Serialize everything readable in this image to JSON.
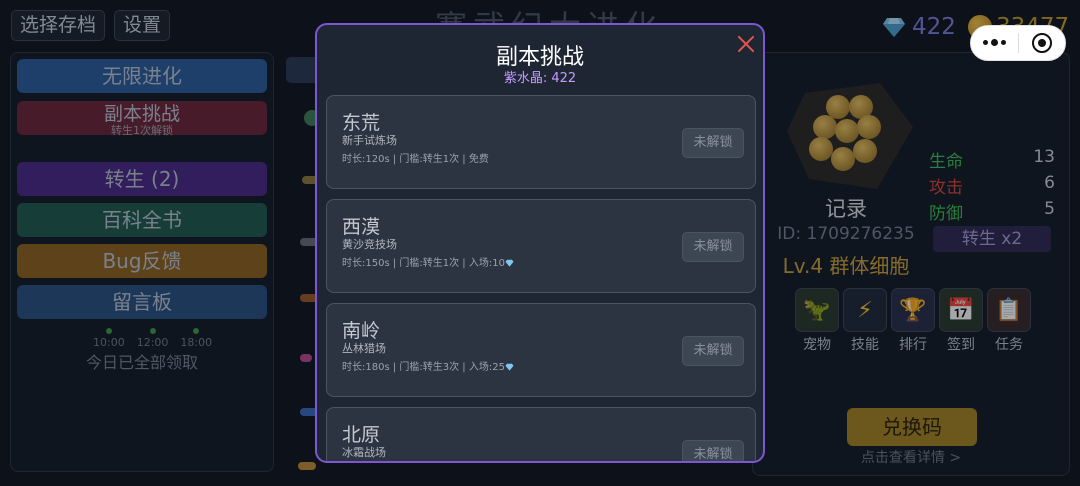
{
  "topbar": {
    "save_select_label": "选择存档",
    "settings_label": "设置",
    "game_title": "赛武纪大进化",
    "gems": "422",
    "coins": "33477"
  },
  "left_menu": {
    "items": [
      {
        "label": "无限进化",
        "color": "#2a5c9a"
      },
      {
        "label": "副本挑战",
        "sub": "转生1次解锁",
        "color": "#6a2637"
      },
      {
        "label": "转生 (2)",
        "color": "#4a2a84"
      },
      {
        "label": "百科全书",
        "color": "#1f5a4e"
      },
      {
        "label": "Bug反馈",
        "color": "#8c6220"
      },
      {
        "label": "留言板",
        "color": "#28517e"
      }
    ],
    "checkin_times": [
      "10:00",
      "12:00",
      "18:00"
    ],
    "checkin_note": "今日已全部领取"
  },
  "right_panel": {
    "stats": [
      {
        "label": "生命",
        "value": "13",
        "color": "#3fbf53"
      },
      {
        "label": "攻击",
        "value": "6",
        "color": "#d4463a"
      },
      {
        "label": "防御",
        "value": "5",
        "color": "#3fbf53"
      }
    ],
    "record_title": "记录",
    "record_id": "ID: 1709276235",
    "level_text": "Lv.4 群体细胞",
    "rebirth_badge": "转生 x2",
    "actions": [
      {
        "label": "宠物",
        "icon": "dinosaur-icon",
        "glyph": "🦖"
      },
      {
        "label": "技能",
        "icon": "lightning-icon",
        "glyph": "⚡"
      },
      {
        "label": "排行",
        "icon": "trophy-icon",
        "glyph": "🏆"
      },
      {
        "label": "签到",
        "icon": "calendar-icon",
        "glyph": "📅"
      },
      {
        "label": "任务",
        "icon": "clipboard-icon",
        "glyph": "📋"
      }
    ],
    "redeem_label": "兑换码",
    "redeem_note": "点击查看详情 >"
  },
  "modal": {
    "title": "副本挑战",
    "subtitle": "紫水晶: 422",
    "stages": [
      {
        "name": "东荒",
        "desc": "新手试炼场",
        "info": "时长:120s | 门槛:转生1次 | 免费",
        "has_gem": false,
        "button": "未解锁"
      },
      {
        "name": "西漠",
        "desc": "黄沙竞技场",
        "info": "时长:150s | 门槛:转生1次 | 入场:10",
        "has_gem": true,
        "button": "未解锁"
      },
      {
        "name": "南岭",
        "desc": "丛林猎场",
        "info": "时长:180s | 门槛:转生3次 | 入场:25",
        "has_gem": true,
        "button": "未解锁"
      },
      {
        "name": "北原",
        "desc": "冰霜战场",
        "info": "",
        "has_gem": false,
        "button": "未解锁"
      }
    ]
  }
}
